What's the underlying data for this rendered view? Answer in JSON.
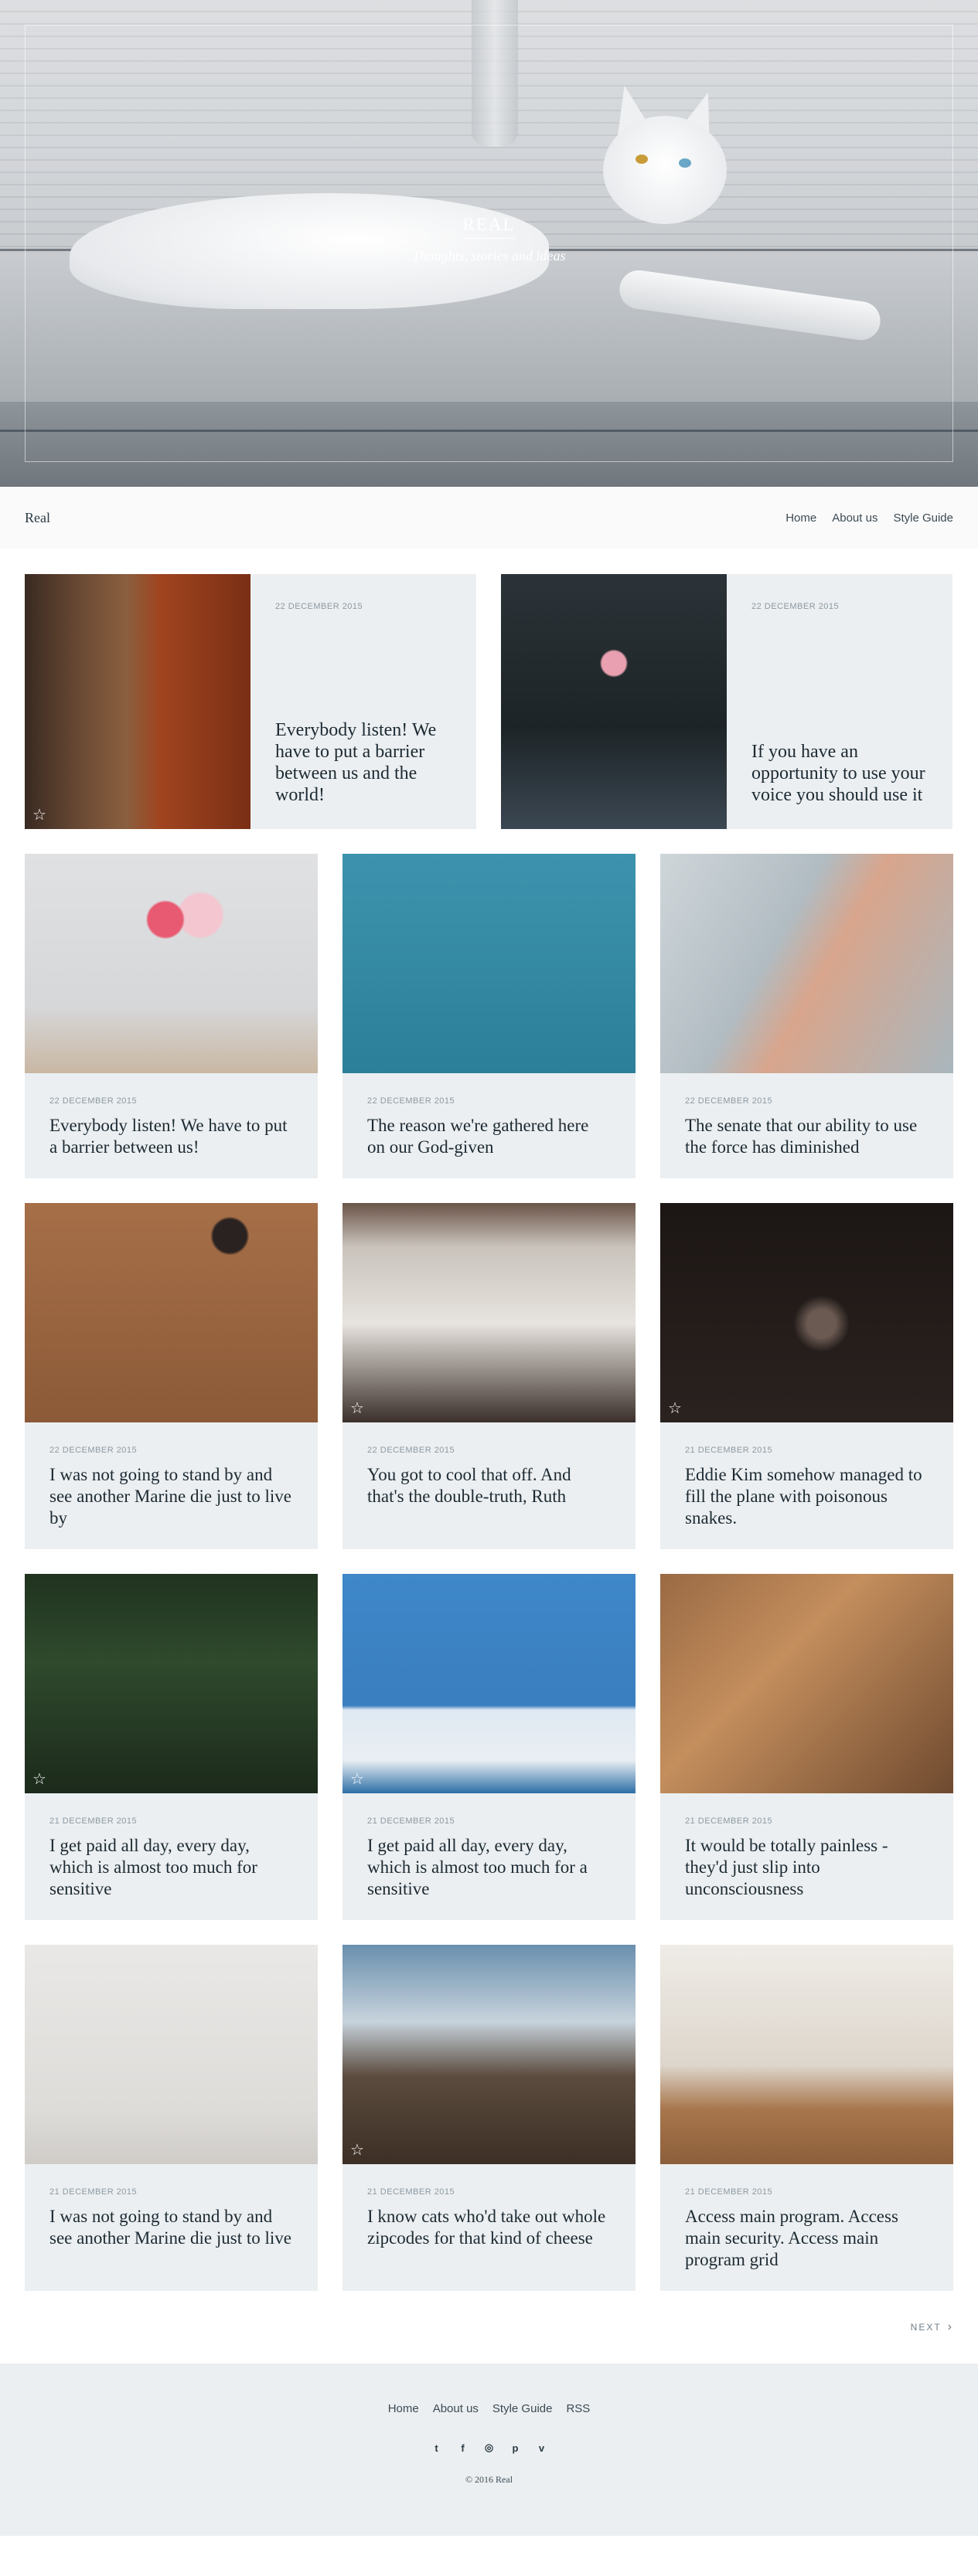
{
  "hero": {
    "site_title": "REAL",
    "tagline": "Thoughts, stories and ideas"
  },
  "nav": {
    "brand": "Real",
    "links": [
      "Home",
      "About us",
      "Style Guide"
    ]
  },
  "featured_posts": [
    {
      "date": "22 DECEMBER 2015",
      "title": "Everybody listen! We have to put a barrier between us and the world!",
      "starred": true,
      "image": "subway-platform"
    },
    {
      "date": "22 DECEMBER 2015",
      "title": "If you have an opportunity to use your voice you should use it",
      "starred": false,
      "image": "person-holding-rose"
    }
  ],
  "posts": [
    {
      "date": "22 DECEMBER 2015",
      "title": "Everybody listen! We have to put a barrier between us!",
      "starred": false,
      "image": "flowers-in-vase"
    },
    {
      "date": "22 DECEMBER 2015",
      "title": "The reason we're gathered here on our God-given",
      "starred": false,
      "image": "white-building"
    },
    {
      "date": "22 DECEMBER 2015",
      "title": "The senate that our ability to use the force has diminished",
      "starred": false,
      "image": "smart-watch"
    },
    {
      "date": "22 DECEMBER 2015",
      "title": "I was not going to stand by and see another Marine die just to live by",
      "starred": false,
      "image": "notebook-writing"
    },
    {
      "date": "22 DECEMBER 2015",
      "title": "You got to cool that off. And that's the double-truth, Ruth",
      "starred": true,
      "image": "townhouse"
    },
    {
      "date": "21 DECEMBER 2015",
      "title": "Eddie Kim somehow managed to fill the plane with poisonous snakes.",
      "starred": true,
      "image": "hand-holding-phone"
    },
    {
      "date": "21 DECEMBER 2015",
      "title": "I get paid all day, every day, which is almost too much for sensitive",
      "starred": true,
      "image": "forest-hiker"
    },
    {
      "date": "21 DECEMBER 2015",
      "title": "I get paid all day, every day, which is almost too much for a sensitive",
      "starred": true,
      "image": "blue-table"
    },
    {
      "date": "21 DECEMBER 2015",
      "title": "It would be totally painless - they'd just slip into unconsciousness",
      "starred": false,
      "image": "desk-items"
    },
    {
      "date": "21 DECEMBER 2015",
      "title": "I was not going to stand by and see another Marine die just to live",
      "starred": false,
      "image": "chair-and-desk"
    },
    {
      "date": "21 DECEMBER 2015",
      "title": "I know cats who'd take out whole zipcodes for that kind of cheese",
      "starred": true,
      "image": "mountain"
    },
    {
      "date": "21 DECEMBER 2015",
      "title": "Access main program. Access main security. Access main program grid",
      "starred": false,
      "image": "dining-room"
    }
  ],
  "pagination": {
    "next_label": "NEXT",
    "next_icon": "chevron-right-icon"
  },
  "footer": {
    "links": [
      "Home",
      "About us",
      "Style Guide",
      "RSS"
    ],
    "social": [
      {
        "name": "twitter-icon",
        "glyph": "t"
      },
      {
        "name": "facebook-icon",
        "glyph": "f"
      },
      {
        "name": "instagram-icon",
        "glyph": "◎"
      },
      {
        "name": "pinterest-icon",
        "glyph": "p"
      },
      {
        "name": "vimeo-icon",
        "glyph": "v"
      }
    ],
    "copyright": "© 2016 Real"
  }
}
